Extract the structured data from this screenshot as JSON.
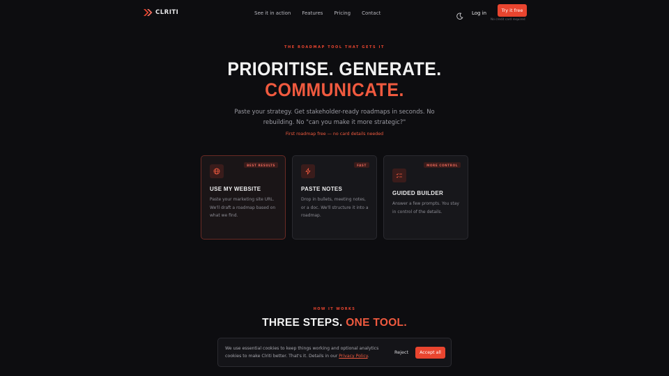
{
  "nav": {
    "logo_text": "CLRITI",
    "links": [
      "See it in action",
      "Features",
      "Pricing",
      "Contact"
    ],
    "login_label": "Log in",
    "cta_label": "Try it free",
    "cta_note": "No credit card required",
    "icons": {
      "logo": "chevron-logo-icon",
      "theme": "moon-icon"
    }
  },
  "hero": {
    "eyebrow": "THE ROADMAP TOOL THAT GETS IT",
    "headline_line1": "PRIORITISE. GENERATE.",
    "headline_line2": "COMMUNICATE.",
    "subtitle": "Paste your strategy. Get stakeholder-ready roadmaps in seconds. No rebuilding. No \"can you make it more strategic?\"",
    "free_note": "First roadmap free — no card details needed"
  },
  "cards": [
    {
      "title": "USE MY WEBSITE",
      "badge": "BEST RESULTS",
      "icon": "globe-icon",
      "selected": true,
      "description": "Paste your marketing site URL. We'll draft a roadmap based on what we find."
    },
    {
      "title": "PASTE NOTES",
      "badge": "FAST",
      "icon": "lightning-icon",
      "selected": false,
      "description": "Drop in bullets, meeting notes, or a doc. We'll structure it into a roadmap."
    },
    {
      "title": "GUIDED BUILDER",
      "badge": "MORE CONTROL",
      "icon": "list-check-icon",
      "selected": false,
      "description": "Answer a few prompts. You stay in control of the details."
    }
  ],
  "how_it_works": {
    "eyebrow": "HOW IT WORKS",
    "title_white": "THREE STEPS.",
    "title_orange": "ONE TOOL."
  },
  "cookie": {
    "text_before_link": "We use essential cookies to keep things working and optional analytics cookies to make Clriti better. That's it. Details in our ",
    "link_label": "Privacy Policy",
    "text_after_link": ".",
    "reject_label": "Reject",
    "accept_label": "Accept all"
  },
  "colors": {
    "accent": "#e9452f",
    "background": "#0d0d10",
    "card": "#17171b"
  }
}
